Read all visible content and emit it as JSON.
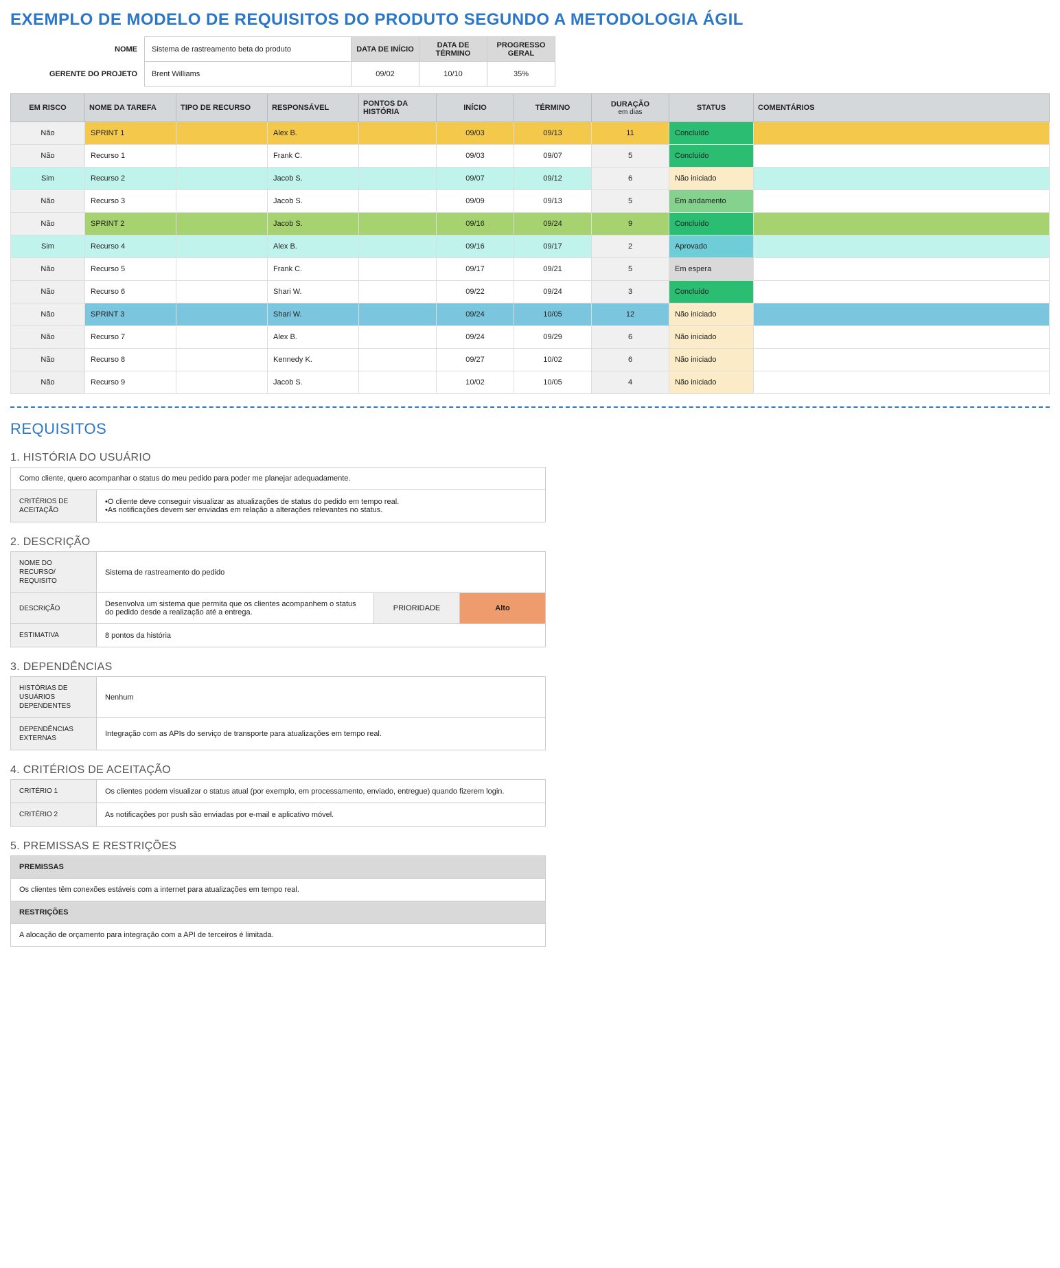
{
  "title": "EXEMPLO DE MODELO DE REQUISITOS DO PRODUTO SEGUNDO A METODOLOGIA ÁGIL",
  "meta": {
    "name_label": "NOME",
    "name_value": "Sistema de rastreamento beta do produto",
    "pm_label": "GERENTE DO PROJETO",
    "pm_value": "Brent Williams",
    "start_label": "DATA DE INÍCIO",
    "end_label": "DATA DE TÉRMINO",
    "progress_label": "PROGRESSO GERAL",
    "start_value": "09/02",
    "end_value": "10/10",
    "progress_value": "35%"
  },
  "task_headers": {
    "risk": "EM RISCO",
    "name": "NOME DA TAREFA",
    "type": "TIPO DE RECURSO",
    "resp": "RESPONSÁVEL",
    "points": "PONTOS DA HISTÓRIA",
    "start": "INÍCIO",
    "end": "TÉRMINO",
    "dur": "DURAÇÃO",
    "dur_sub": "em dias",
    "status": "STATUS",
    "comments": "COMENTÁRIOS"
  },
  "tasks": [
    {
      "risk": "Não",
      "name": "SPRINT 1",
      "type": "",
      "resp": "Alex B.",
      "points": "",
      "start": "09/03",
      "end": "09/13",
      "dur": "11",
      "status": "Concluído",
      "comments": "",
      "row_bg": "bg-yellow",
      "risk_bg": "bg-grey",
      "dur_bg": "bg-yellow",
      "stat_bg": "bg-green"
    },
    {
      "risk": "Não",
      "name": "Recurso 1",
      "type": "",
      "resp": "Frank C.",
      "points": "",
      "start": "09/03",
      "end": "09/07",
      "dur": "5",
      "status": "Concluído",
      "comments": "",
      "row_bg": "bg-white",
      "risk_bg": "bg-grey",
      "dur_bg": "bg-grey",
      "stat_bg": "bg-green"
    },
    {
      "risk": "Sim",
      "name": "Recurso 2",
      "type": "",
      "resp": "Jacob S.",
      "points": "",
      "start": "09/07",
      "end": "09/12",
      "dur": "6",
      "status": "Não iniciado",
      "comments": "",
      "row_bg": "bg-mint",
      "risk_bg": "bg-mint",
      "dur_bg": "bg-grey",
      "stat_bg": "bg-cream"
    },
    {
      "risk": "Não",
      "name": "Recurso 3",
      "type": "",
      "resp": "Jacob S.",
      "points": "",
      "start": "09/09",
      "end": "09/13",
      "dur": "5",
      "status": "Em andamento",
      "comments": "",
      "row_bg": "bg-white",
      "risk_bg": "bg-grey",
      "dur_bg": "bg-grey",
      "stat_bg": "bg-lgreen"
    },
    {
      "risk": "Não",
      "name": "SPRINT 2",
      "type": "",
      "resp": "Jacob S.",
      "points": "",
      "start": "09/16",
      "end": "09/24",
      "dur": "9",
      "status": "Concluído",
      "comments": "",
      "row_bg": "bg-lime",
      "risk_bg": "bg-grey",
      "dur_bg": "bg-lime",
      "stat_bg": "bg-green"
    },
    {
      "risk": "Sim",
      "name": "Recurso 4",
      "type": "",
      "resp": "Alex B.",
      "points": "",
      "start": "09/16",
      "end": "09/17",
      "dur": "2",
      "status": "Aprovado",
      "comments": "",
      "row_bg": "bg-mint",
      "risk_bg": "bg-mint",
      "dur_bg": "bg-grey",
      "stat_bg": "bg-teal"
    },
    {
      "risk": "Não",
      "name": "Recurso 5",
      "type": "",
      "resp": "Frank C.",
      "points": "",
      "start": "09/17",
      "end": "09/21",
      "dur": "5",
      "status": "Em espera",
      "comments": "",
      "row_bg": "bg-white",
      "risk_bg": "bg-grey",
      "dur_bg": "bg-grey",
      "stat_bg": "bg-dgrey"
    },
    {
      "risk": "Não",
      "name": "Recurso 6",
      "type": "",
      "resp": "Shari W.",
      "points": "",
      "start": "09/22",
      "end": "09/24",
      "dur": "3",
      "status": "Concluído",
      "comments": "",
      "row_bg": "bg-white",
      "risk_bg": "bg-grey",
      "dur_bg": "bg-grey",
      "stat_bg": "bg-green"
    },
    {
      "risk": "Não",
      "name": "SPRINT 3",
      "type": "",
      "resp": "Shari W.",
      "points": "",
      "start": "09/24",
      "end": "10/05",
      "dur": "12",
      "status": "Não iniciado",
      "comments": "",
      "row_bg": "bg-sky",
      "risk_bg": "bg-grey",
      "dur_bg": "bg-sky",
      "stat_bg": "bg-cream"
    },
    {
      "risk": "Não",
      "name": "Recurso 7",
      "type": "",
      "resp": "Alex B.",
      "points": "",
      "start": "09/24",
      "end": "09/29",
      "dur": "6",
      "status": "Não iniciado",
      "comments": "",
      "row_bg": "bg-white",
      "risk_bg": "bg-grey",
      "dur_bg": "bg-grey",
      "stat_bg": "bg-cream"
    },
    {
      "risk": "Não",
      "name": "Recurso 8",
      "type": "",
      "resp": "Kennedy K.",
      "points": "",
      "start": "09/27",
      "end": "10/02",
      "dur": "6",
      "status": "Não iniciado",
      "comments": "",
      "row_bg": "bg-white",
      "risk_bg": "bg-grey",
      "dur_bg": "bg-grey",
      "stat_bg": "bg-cream"
    },
    {
      "risk": "Não",
      "name": "Recurso 9",
      "type": "",
      "resp": "Jacob S.",
      "points": "",
      "start": "10/02",
      "end": "10/05",
      "dur": "4",
      "status": "Não iniciado",
      "comments": "",
      "row_bg": "bg-white",
      "risk_bg": "bg-grey",
      "dur_bg": "bg-grey",
      "stat_bg": "bg-cream"
    }
  ],
  "req_title": "REQUISITOS",
  "sec1": {
    "hd": "1. HISTÓRIA DO USUÁRIO",
    "story": "Como cliente, quero acompanhar o status do meu pedido para poder me planejar adequadamente.",
    "crit_label": "CRITÉRIOS DE ACEITAÇÃO",
    "crit_text": "•O cliente deve conseguir visualizar as atualizações de status do pedido em tempo real.\n•As notificações devem ser enviadas em relação a alterações relevantes no status."
  },
  "sec2": {
    "hd": "2. DESCRIÇÃO",
    "name_label": "NOME DO RECURSO/ REQUISITO",
    "name_value": "Sistema de rastreamento do pedido",
    "desc_label": "DESCRIÇÃO",
    "desc_value": "Desenvolva um sistema que permita que os clientes acompanhem o status do pedido desde a realização até a entrega.",
    "prio_label": "PRIORIDADE",
    "prio_value": "Alto",
    "est_label": "ESTIMATIVA",
    "est_value": "8 pontos da história"
  },
  "sec3": {
    "hd": "3. DEPENDÊNCIAS",
    "dep1_label": "HISTÓRIAS DE USUÁRIOS DEPENDENTES",
    "dep1_value": "Nenhum",
    "dep2_label": "DEPENDÊNCIAS EXTERNAS",
    "dep2_value": "Integração com as APIs do serviço de transporte para atualizações em tempo real."
  },
  "sec4": {
    "hd": "4. CRITÉRIOS DE ACEITAÇÃO",
    "c1_label": "CRITÉRIO 1",
    "c1_value": "Os clientes podem visualizar o status atual (por exemplo, em processamento, enviado, entregue) quando fizerem login.",
    "c2_label": "CRITÉRIO 2",
    "c2_value": "As notificações por push são enviadas por e-mail e aplicativo móvel."
  },
  "sec5": {
    "hd": "5. PREMISSAS E RESTRIÇÕES",
    "prem_label": "PREMISSAS",
    "prem_value": "Os clientes têm conexões estáveis com a internet para atualizações em tempo real.",
    "rest_label": "RESTRIÇÕES",
    "rest_value": "A alocação de orçamento para integração com a API de terceiros é limitada."
  }
}
